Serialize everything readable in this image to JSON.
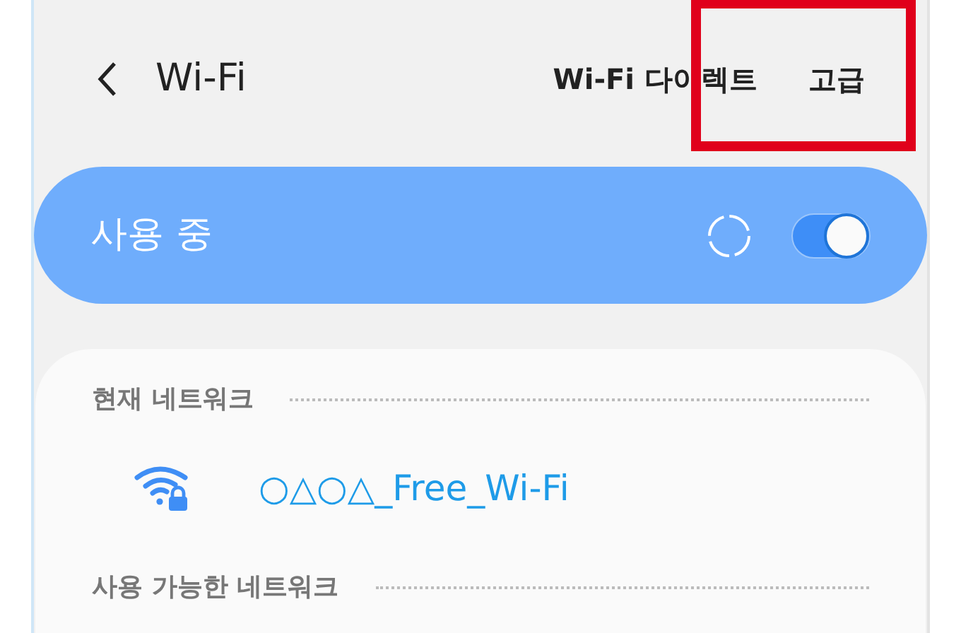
{
  "header": {
    "title": "Wi-Fi",
    "actions": [
      {
        "label": "Wi-Fi 다이렉트",
        "highlighted": false
      },
      {
        "label": "고급",
        "highlighted": true
      }
    ]
  },
  "master_switch": {
    "label": "사용 중",
    "on": true,
    "scanning": true
  },
  "sections": [
    {
      "title": "현재 네트워크",
      "networks": [
        {
          "name": "○△○△_Free_Wi-Fi",
          "secured": true
        }
      ]
    },
    {
      "title": "사용 가능한 네트워크"
    }
  ]
}
